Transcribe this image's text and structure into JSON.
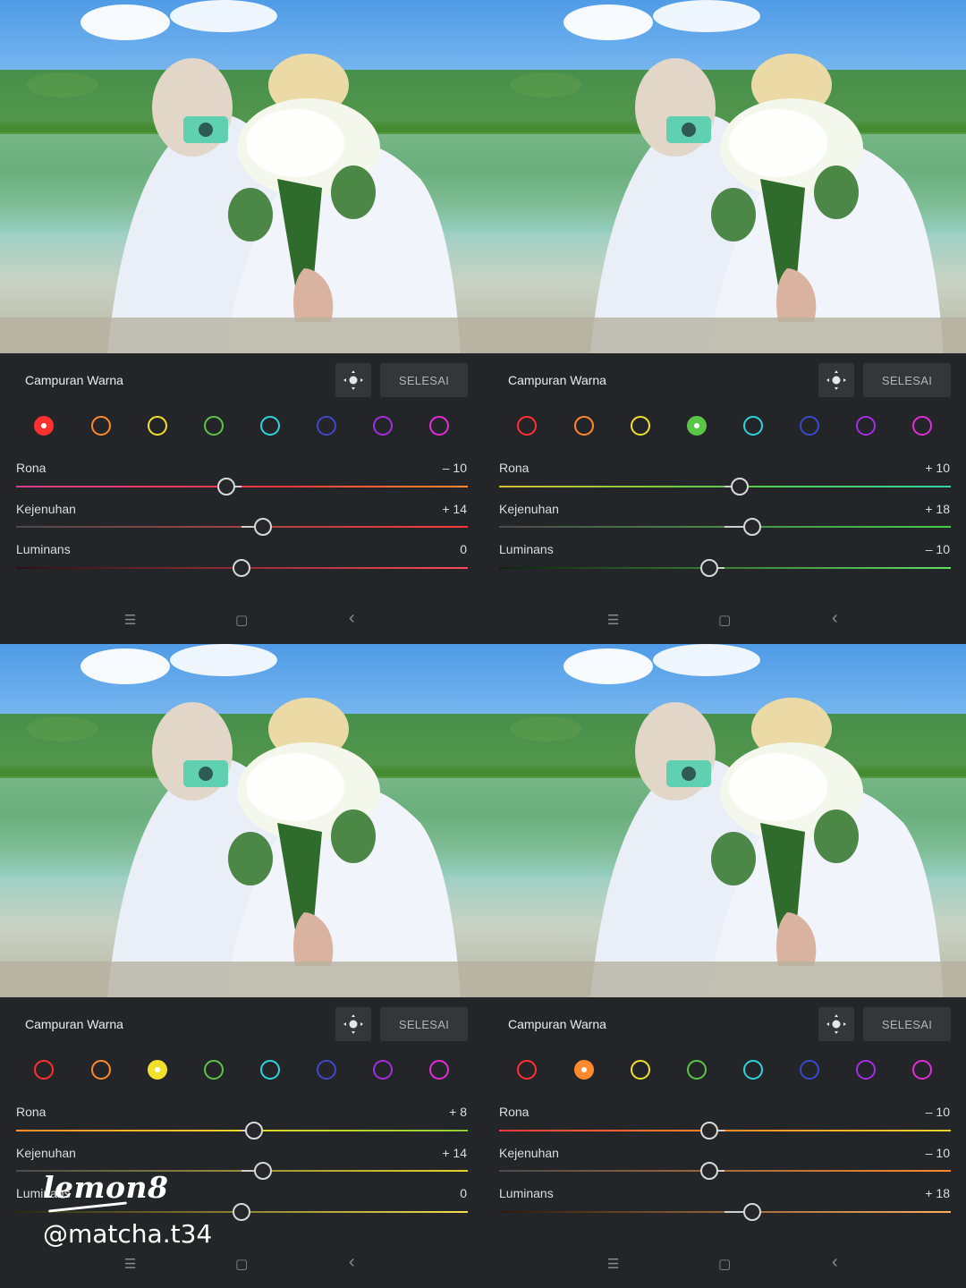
{
  "panels": [
    {
      "title": "Campuran Warna",
      "done_label": "SELESAI",
      "selected_color": 0,
      "sliders": [
        {
          "label": "Rona",
          "value": "– 10",
          "level": -10,
          "gradient": "linear-gradient(90deg,#d23b8a,#ff3b3b 60%,#ff8a2b)"
        },
        {
          "label": "Kejenuhan",
          "value": "+ 14",
          "level": 14,
          "gradient": "linear-gradient(90deg,#4a4a4a,#ff3b3b)"
        },
        {
          "label": "Luminans",
          "value": "0",
          "level": 0,
          "gradient": "linear-gradient(90deg,#2a1215,#ff4a5a)"
        }
      ]
    },
    {
      "title": "Campuran Warna",
      "done_label": "SELESAI",
      "selected_color": 3,
      "sliders": [
        {
          "label": "Rona",
          "value": "+ 10",
          "level": 10,
          "gradient": "linear-gradient(90deg,#d6c232,#4fcf4a 55%,#39d3a0)"
        },
        {
          "label": "Kejenuhan",
          "value": "+ 18",
          "level": 18,
          "gradient": "linear-gradient(90deg,#4a4a4a,#44cf48)"
        },
        {
          "label": "Luminans",
          "value": "– 10",
          "level": -10,
          "gradient": "linear-gradient(90deg,#10220f,#60e060)"
        }
      ]
    },
    {
      "title": "Campuran Warna",
      "done_label": "SELESAI",
      "selected_color": 2,
      "sliders": [
        {
          "label": "Rona",
          "value": "+ 8",
          "level": 8,
          "gradient": "linear-gradient(90deg,#ff8a2b,#e8d626 50%,#8ad035)"
        },
        {
          "label": "Kejenuhan",
          "value": "+ 14",
          "level": 14,
          "gradient": "linear-gradient(90deg,#4a4a4a,#e4d624)"
        },
        {
          "label": "Luminans",
          "value": "0",
          "level": 0,
          "gradient": "linear-gradient(90deg,#2a2810,#f0e050)"
        }
      ]
    },
    {
      "title": "Campuran Warna",
      "done_label": "SELESAI",
      "selected_color": 1,
      "sliders": [
        {
          "label": "Rona",
          "value": "– 10",
          "level": -10,
          "gradient": "linear-gradient(90deg,#ff3b3b,#ff8a2b 50%,#e8d626)"
        },
        {
          "label": "Kejenuhan",
          "value": "– 10",
          "level": -10,
          "gradient": "linear-gradient(90deg,#4a4a4a,#ff8a2b)"
        },
        {
          "label": "Luminans",
          "value": "+ 18",
          "level": 18,
          "gradient": "linear-gradient(90deg,#2a1a0c,#ffb060)"
        }
      ]
    }
  ],
  "color_swatches": [
    {
      "name": "red",
      "color": "#ff3030"
    },
    {
      "name": "orange",
      "color": "#ff8a2b"
    },
    {
      "name": "yellow",
      "color": "#f2e12a"
    },
    {
      "name": "green",
      "color": "#59c647"
    },
    {
      "name": "aqua",
      "color": "#2dd3e0"
    },
    {
      "name": "blue",
      "color": "#3b49c9"
    },
    {
      "name": "purple",
      "color": "#a12ee0"
    },
    {
      "name": "magenta",
      "color": "#e02ed8"
    }
  ],
  "nav_icons": [
    "menu-icon",
    "home-square-icon",
    "back-chevron-icon"
  ],
  "watermark": {
    "logo": "lemon8",
    "handle": "@matcha.t34"
  }
}
